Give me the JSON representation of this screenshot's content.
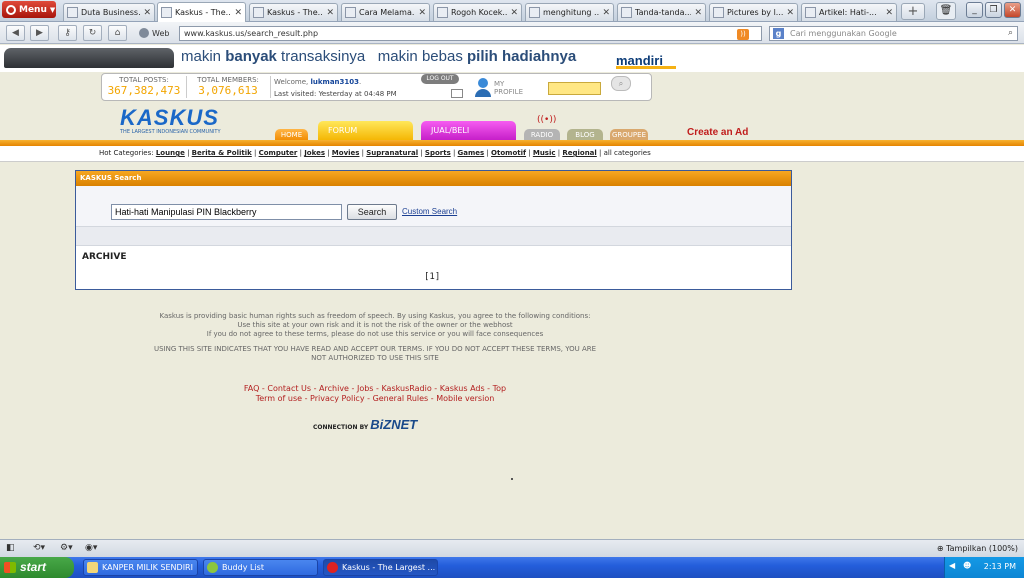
{
  "browser": {
    "menu_label": "Menu",
    "tabs": [
      {
        "title": "Duta Business..."
      },
      {
        "title": "Kaskus - The..."
      },
      {
        "title": "Kaskus - The..."
      },
      {
        "title": "Cara Melama..."
      },
      {
        "title": "Rogoh Kocek..."
      },
      {
        "title": "menghitung ..."
      },
      {
        "title": "Tanda-tanda..."
      },
      {
        "title": "Pictures by l..."
      },
      {
        "title": "Artikel: Hati-..."
      }
    ],
    "active_tab_index": 1,
    "web_label": "Web",
    "url": "www.kaskus.us/search_result.php",
    "search_placeholder": "Cari menggunakan Google"
  },
  "banner": {
    "text_regular_1": "makin ",
    "text_bold_1": "banyak",
    "text_regular_2": " transaksinya   makin bebas ",
    "text_bold_2": "pilih hadiahnya",
    "brand": "mandiri"
  },
  "stats": {
    "posts_label": "TOTAL POSTS:",
    "posts_value": "367,382,473",
    "members_label": "TOTAL MEMBERS:",
    "members_value": "3,076,613",
    "welcome_prefix": "Welcome, ",
    "username": "lukman3103",
    "welcome_suffix": ".",
    "last_visit_label": "Last visited: Yesterday at ",
    "last_visit_time": "04:48 PM",
    "logout_label": "LOG OUT",
    "my_label": "MY",
    "profile_label": "PROFILE"
  },
  "logo": {
    "word": "KASKUS",
    "tagline": "THE LARGEST INDONESIAN COMMUNITY"
  },
  "nav_tabs": {
    "home": "HOME",
    "forum": "FORUM",
    "jualbeli": "JUAL/BELI",
    "radio": "RADIO",
    "blog": "BLOG",
    "groupee": "GROUPEE",
    "create_ad": "Create an Ad"
  },
  "hot_categories": {
    "label": "Hot Categories: ",
    "items": [
      "Lounge",
      "Berita & Politik",
      "Computer",
      "Jokes",
      "Movies",
      "Supranatural",
      "Sports",
      "Games",
      "Otomotif",
      "Music",
      "Regional"
    ],
    "all": "all categories"
  },
  "search": {
    "header": "KASKUS Search",
    "query": "Hati-hati Manipulasi PIN Blackberry",
    "button": "Search",
    "custom_link": "Custom Search",
    "archive_label": "ARCHIVE",
    "page_indicator": "[1]"
  },
  "legal": {
    "line1": "Kaskus is providing basic human rights such as freedom of speech. By using Kaskus, you agree to the following conditions:",
    "line2": "Use this site at your own risk and it is not the risk of the owner or the webhost",
    "line3": "If you do not agree to these terms, please do not use this service or you will face consequences",
    "line4": "USING THIS SITE INDICATES THAT YOU HAVE READ AND ACCEPT OUR TERMS. IF YOU DO NOT ACCEPT THESE TERMS, YOU ARE",
    "line5": "NOT AUTHORIZED TO USE THIS SITE"
  },
  "footer": {
    "row1": [
      "FAQ",
      "Contact Us",
      "Archive",
      "Jobs",
      "KaskusRadio",
      "Kaskus Ads",
      "Top"
    ],
    "row2": [
      "Term of use",
      "Privacy Policy",
      "General Rules",
      "Mobile version"
    ],
    "connection_label": "CONNECTION BY ",
    "sponsor": "BiZNET"
  },
  "statusbar": {
    "zoom_label": "Tampilkan (100%)"
  },
  "taskbar": {
    "start": "start",
    "tasks": [
      {
        "label": "KANPER MILIK SENDIRI"
      },
      {
        "label": "Buddy List"
      },
      {
        "label": "Kaskus - The Largest ..."
      }
    ],
    "clock": "2:13 PM"
  },
  "colors": {
    "accent_orange": "#f2a500",
    "header_orange": "#e48400",
    "link_blue": "#1b3f92",
    "footer_red": "#b32020"
  }
}
